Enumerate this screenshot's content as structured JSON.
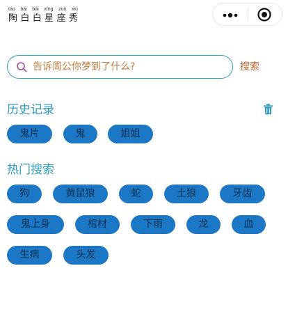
{
  "header": {
    "brand_pinyin": [
      "táo",
      "bái",
      "bái",
      "xīng",
      "zuò",
      "xiù"
    ],
    "brand_hanzi": [
      "陶",
      "白",
      "白",
      "星",
      "座",
      "秀"
    ],
    "capsule_icons": [
      "more-icon",
      "close-circle-icon"
    ]
  },
  "search": {
    "placeholder": "告诉周公你梦到了什么?",
    "value": "",
    "button_label": "搜索",
    "border_color": "#2aa0b8",
    "icon": "search-icon"
  },
  "history": {
    "title": "历史记录",
    "clear_icon": "trash-icon",
    "tags": [
      "鬼片",
      "鬼",
      "姐姐"
    ]
  },
  "hot": {
    "title": "热门搜索",
    "tags": [
      "狗",
      "黄鼠狼",
      "蛇",
      "土狼",
      "牙齿",
      "鬼上身",
      "棺材",
      "下雨",
      "龙",
      "血",
      "生病",
      "头发"
    ]
  },
  "colors": {
    "accent": "#2d9bbf",
    "tag_bg": "#1c78c4",
    "tag_text": "#0a2f55",
    "search_button": "#c5642a",
    "placeholder": "#c87b3a"
  }
}
